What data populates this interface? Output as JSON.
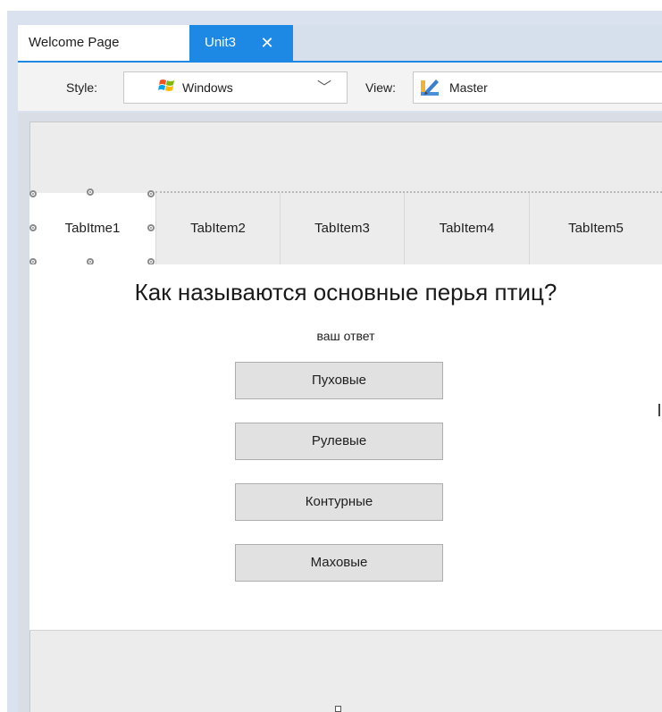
{
  "tabs": {
    "welcome_label": "Welcome Page",
    "active_label": "Unit3",
    "close_glyph": "✕"
  },
  "toolbar": {
    "style_label": "Style:",
    "style_value": "Windows",
    "style_icon": "windows-flag-icon",
    "view_label": "View:",
    "view_value": "Master",
    "view_icon": "pencil-ruler-icon",
    "dropdown_glyph": "﹀"
  },
  "tab_control": {
    "items": [
      {
        "label": "TabItme1",
        "selected": true
      },
      {
        "label": "TabItem2",
        "selected": false
      },
      {
        "label": "TabItem3",
        "selected": false
      },
      {
        "label": "TabItem4",
        "selected": false
      },
      {
        "label": "TabItem5",
        "selected": false
      }
    ]
  },
  "quiz": {
    "question": "Как называются основные перья птиц?",
    "hint": "ваш ответ",
    "answers": [
      "Пуховые",
      "Рулевые",
      "Контурные",
      "Маховые"
    ]
  },
  "colors": {
    "accent": "#1e88e5",
    "tab_strip": "#d6dfec",
    "canvas": "#ececec",
    "button_face": "#e1e1e1"
  }
}
